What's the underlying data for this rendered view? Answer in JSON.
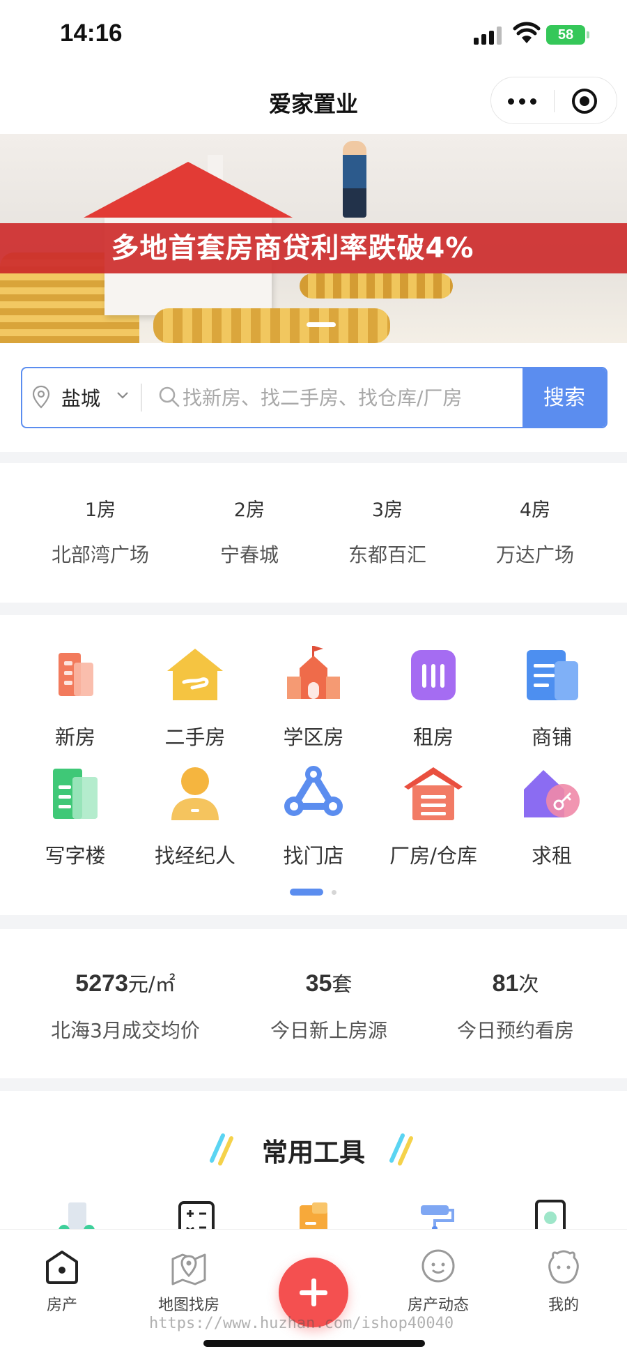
{
  "status_bar": {
    "time": "14:16",
    "battery": "58"
  },
  "nav": {
    "title": "爱家置业"
  },
  "banner": {
    "headline": "多地首套房商贷利率跌破4%"
  },
  "search": {
    "city": "盐城",
    "placeholder": "找新房、找二手房、找仓库/厂房",
    "button": "搜索"
  },
  "rooms": [
    {
      "num": "1房",
      "name": "北部湾广场"
    },
    {
      "num": "2房",
      "name": "宁春城"
    },
    {
      "num": "3房",
      "name": "东都百汇"
    },
    {
      "num": "4房",
      "name": "万达广场"
    }
  ],
  "categories": [
    {
      "label": "新房",
      "icon": "building-icon"
    },
    {
      "label": "二手房",
      "icon": "house-hand-icon"
    },
    {
      "label": "学区房",
      "icon": "school-icon"
    },
    {
      "label": "租房",
      "icon": "rent-icon"
    },
    {
      "label": "商铺",
      "icon": "shop-icon"
    },
    {
      "label": "写字楼",
      "icon": "office-icon"
    },
    {
      "label": "找经纪人",
      "icon": "agent-icon"
    },
    {
      "label": "找门店",
      "icon": "store-icon"
    },
    {
      "label": "厂房/仓库",
      "icon": "warehouse-icon"
    },
    {
      "label": "求租",
      "icon": "seek-rent-icon"
    }
  ],
  "stats": [
    {
      "value": "5273",
      "unit": "元/㎡",
      "label": "北海3月成交均价"
    },
    {
      "value": "35",
      "unit": "套",
      "label": "今日新上房源"
    },
    {
      "value": "81",
      "unit": "次",
      "label": "今日预约看房"
    }
  ],
  "tools": {
    "title": "常用工具"
  },
  "tabbar": [
    {
      "label": "房产",
      "icon": "home-icon"
    },
    {
      "label": "地图找房",
      "icon": "map-icon"
    },
    {
      "label": "房产动态",
      "icon": "chat-icon"
    },
    {
      "label": "我的",
      "icon": "profile-icon"
    }
  ],
  "watermark": "https://www.huzhan.com/ishop40040",
  "colors": {
    "accent": "#5b8def",
    "fab": "#f45050",
    "banner_ribbon": "#cd2d2d"
  }
}
